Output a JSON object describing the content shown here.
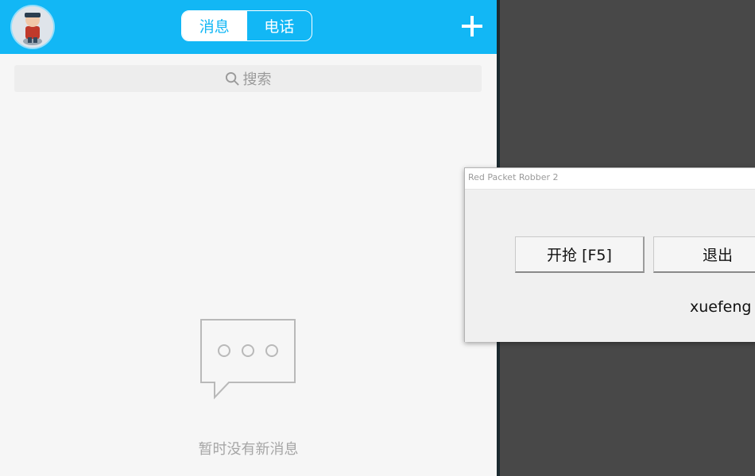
{
  "messenger": {
    "avatar_icon": "user-avatar-icon",
    "tabs": [
      {
        "label": "消息",
        "active": true
      },
      {
        "label": "电话",
        "active": false
      }
    ],
    "add_icon": "plus-icon",
    "search": {
      "placeholder": "搜索",
      "icon": "search-icon"
    },
    "empty_state": {
      "icon": "chat-bubble-icon",
      "text": "暂时没有新消息"
    },
    "colors": {
      "header": "#12b7f5",
      "background": "#f6f6f6"
    }
  },
  "rpr_window": {
    "title": "Red Packet Robber 2",
    "start_label": "开抢 [F5]",
    "exit_label": "退出",
    "author": "xuefeng"
  },
  "desktop": {
    "background": "#484848"
  }
}
